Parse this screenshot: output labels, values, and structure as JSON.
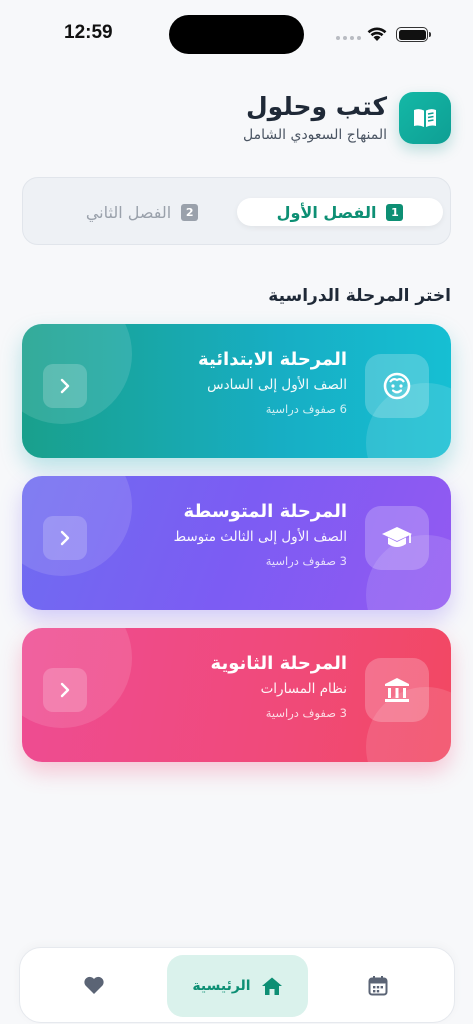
{
  "status_bar": {
    "time": "12:59"
  },
  "header": {
    "title": "كتب وحلول",
    "subtitle": "المنهاج السعودي الشامل",
    "logo_icon": "book-icon",
    "accent_color": "#0d8f74"
  },
  "semester_tabs": [
    {
      "number": "1",
      "label": "الفصل الأول",
      "active": true
    },
    {
      "number": "2",
      "label": "الفصل الثاني",
      "active": false
    }
  ],
  "section_title": "اختر المرحلة الدراسية",
  "stages": [
    {
      "title": "المرحلة الابتدائية",
      "subtitle": "الصف الأول إلى السادس",
      "count": "6 صفوف دراسية",
      "icon": "child-face-icon",
      "color": "#17aec4"
    },
    {
      "title": "المرحلة المتوسطة",
      "subtitle": "الصف الأول إلى الثالث متوسط",
      "count": "3 صفوف دراسية",
      "icon": "graduation-cap-icon",
      "color": "#7c5cf3"
    },
    {
      "title": "المرحلة الثانوية",
      "subtitle": "نظام المسارات",
      "count": "3 صفوف دراسية",
      "icon": "institution-icon",
      "color": "#f04a7a"
    }
  ],
  "bottom_nav": {
    "home_label": "الرئيسية",
    "items": [
      "heart-icon",
      "home-icon",
      "calendar-icon"
    ]
  }
}
